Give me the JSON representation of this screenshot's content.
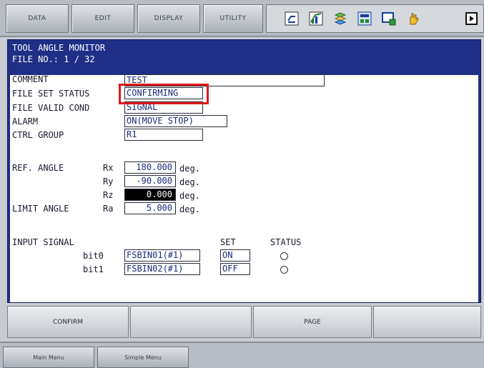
{
  "menu": [
    "DATA",
    "EDIT",
    "DISPLAY",
    "UTILITY"
  ],
  "icons": [
    "direct-open-icon",
    "graph-icon",
    "layer-icon",
    "data-icon",
    "monitor-icon",
    "hand-icon",
    "page-arrow-icon"
  ],
  "header": {
    "title": "TOOL ANGLE MONITOR",
    "file_no": "FILE NO.:  1 / 32"
  },
  "fields": {
    "comment_label": "COMMENT",
    "comment_value": "TEST",
    "file_set_status_label": "FILE SET STATUS",
    "file_set_status_value": "CONFIRMING",
    "file_valid_cond_label": "FILE VALID COND",
    "file_valid_cond_value": "SIGNAL",
    "alarm_label": "ALARM",
    "alarm_value": "ON(MOVE STOP)",
    "ctrl_group_label": "CTRL GROUP",
    "ctrl_group_value": "R1"
  },
  "ref_angle": {
    "label": "REF. ANGLE",
    "rows": [
      {
        "axis": "Rx",
        "value": "180.000",
        "unit": "deg."
      },
      {
        "axis": "Ry",
        "value": "-90.000",
        "unit": "deg."
      },
      {
        "axis": "Rz",
        "value": "0.000",
        "unit": "deg."
      }
    ]
  },
  "limit_angle": {
    "label": "LIMIT ANGLE",
    "axis": "Ra",
    "value": "5.000",
    "unit": "deg."
  },
  "input_signal": {
    "label": "INPUT SIGNAL",
    "set_header": "SET",
    "status_header": "STATUS",
    "rows": [
      {
        "bit": "bit0",
        "signal": "FSBIN01(#1)",
        "set": "ON"
      },
      {
        "bit": "bit1",
        "signal": "FSBIN02(#1)",
        "set": "OFF"
      }
    ]
  },
  "function_keys": [
    "CONFIRM",
    "",
    "",
    "PAGE",
    ""
  ],
  "bottom": {
    "main_menu": "Main Menu",
    "simple_menu": "Simple Menu"
  }
}
